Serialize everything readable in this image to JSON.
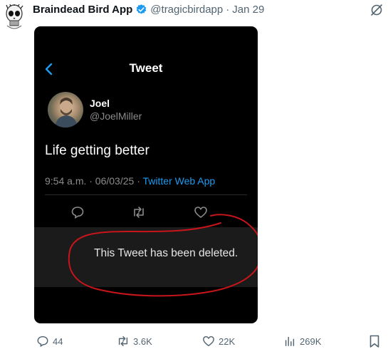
{
  "post": {
    "display_name": "Braindead Bird App",
    "handle": "@tragicbirdapp",
    "separator": "·",
    "date": "Jan 29",
    "avatar_icon": "skull-avatar-icon",
    "verified_color": "#1d9bf0"
  },
  "embedded": {
    "header_title": "Tweet",
    "author_name": "Joel",
    "author_handle": "@JoelMiller",
    "tweet_text": "Life getting better",
    "timestamp": "9:54 a.m. · 06/03/25 · ",
    "source": "Twitter Web App",
    "deleted_message": "This Tweet has been deleted.",
    "annotation_color": "#c8151b"
  },
  "actions": {
    "replies": "44",
    "reposts": "3.6K",
    "likes": "22K",
    "views": "269K"
  }
}
